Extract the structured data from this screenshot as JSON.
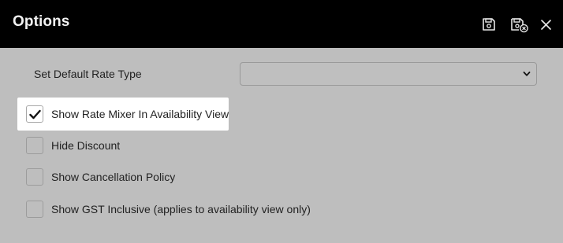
{
  "window": {
    "title": "Options",
    "actions": [
      {
        "name": "save",
        "icon": "save-icon"
      },
      {
        "name": "save-and-close",
        "icon": "save-close-icon"
      },
      {
        "name": "close",
        "icon": "close-icon"
      }
    ]
  },
  "form": {
    "default_rate_type": {
      "label": "Set Default Rate Type",
      "value": ""
    },
    "options": [
      {
        "label": "Show Rate Mixer In Availability View",
        "checked": true
      },
      {
        "label": "Hide Discount",
        "checked": false
      },
      {
        "label": "Show Cancellation Policy",
        "checked": false
      },
      {
        "label": "Show GST Inclusive (applies to availability view only)",
        "checked": false
      }
    ]
  },
  "colors": {
    "header_bg": "#000000",
    "body_bg": "#bebebe",
    "highlight_bg": "#ffffff"
  }
}
